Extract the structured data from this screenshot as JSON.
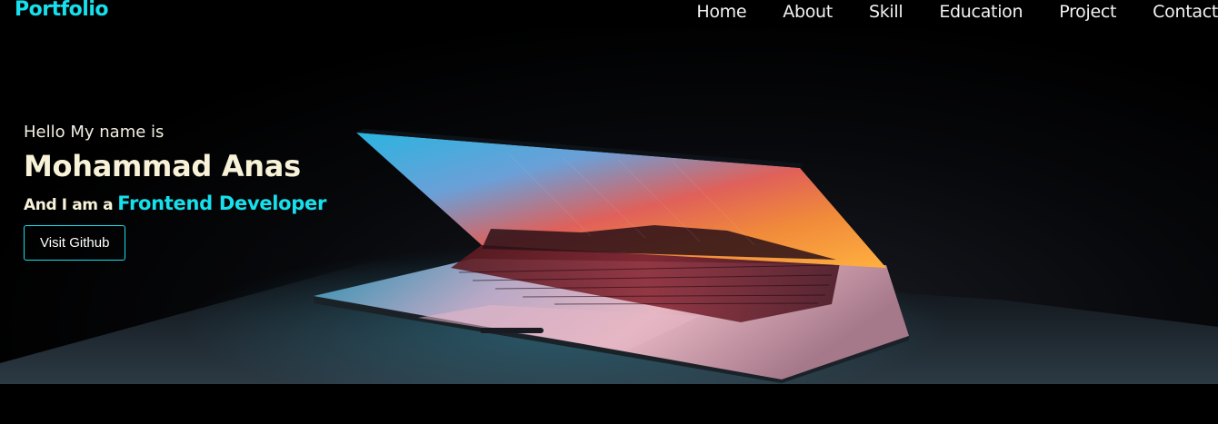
{
  "navbar": {
    "brand": "Portfolio",
    "links": [
      "Home",
      "About",
      "Skill",
      "Education",
      "Project",
      "Contact"
    ]
  },
  "hero": {
    "greeting": "Hello My name is",
    "name": "Mohammad Anas",
    "role_prefix": "And I am a",
    "role_title": "Frontend Developer",
    "button_label": "Visit Github"
  },
  "colors": {
    "accent": "#16e0ec",
    "text_light": "#f7f2d8",
    "background": "#000000"
  }
}
